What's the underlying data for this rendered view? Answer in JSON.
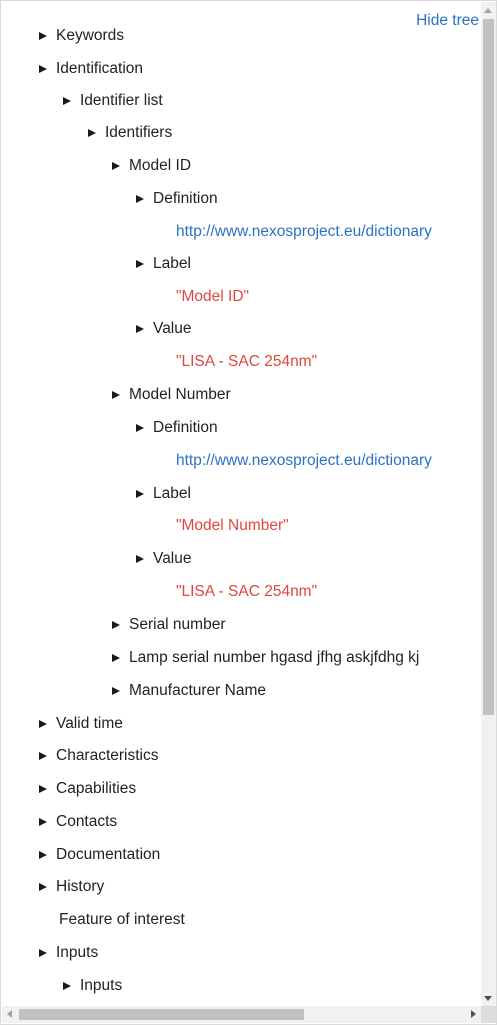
{
  "header": {
    "hide_tree_label": "Hide tree"
  },
  "tree": {
    "keywords": "Keywords",
    "identification": "Identification",
    "identifier_list": "Identifier list",
    "identifiers": "Identifiers",
    "model_id": {
      "label": "Model ID",
      "definition_label": "Definition",
      "definition_value": "http://www.nexosproject.eu/dictionary",
      "label_label": "Label",
      "label_value": "\"Model ID\"",
      "value_label": "Value",
      "value_value": "\"LISA - SAC 254nm\""
    },
    "model_number": {
      "label": "Model Number",
      "definition_label": "Definition",
      "definition_value": "http://www.nexosproject.eu/dictionary",
      "label_label": "Label",
      "label_value": "\"Model Number\"",
      "value_label": "Value",
      "value_value": "\"LISA - SAC 254nm\""
    },
    "serial_number": "Serial number",
    "lamp_serial_number": "Lamp serial number hgasd jfhg askjfdhg kj",
    "manufacturer_name": "Manufacturer Name",
    "valid_time": "Valid time",
    "characteristics": "Characteristics",
    "capabilities": "Capabilities",
    "contacts": "Contacts",
    "documentation": "Documentation",
    "history": "History",
    "feature_of_interest": "Feature of interest",
    "inputs": "Inputs",
    "inputs_child": "Inputs"
  },
  "colors": {
    "link": "#2a72c8",
    "string": "#e0463f",
    "text": "#222222"
  }
}
